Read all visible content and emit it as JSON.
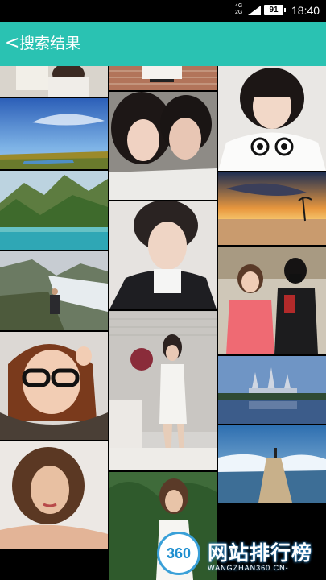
{
  "status_bar": {
    "network_top": "4G",
    "network_bottom": "2G",
    "battery": "91",
    "time": "18:40"
  },
  "app_bar": {
    "back_icon": "<",
    "title": "搜索结果"
  },
  "results": {
    "columns": 3,
    "images": [
      {
        "id": "photo-1",
        "subject": "girl-portrait-top"
      },
      {
        "id": "photo-2",
        "subject": "blue-sky-lake"
      },
      {
        "id": "photo-3",
        "subject": "mountain-lake"
      },
      {
        "id": "photo-4",
        "subject": "glacier-hiker"
      },
      {
        "id": "photo-5",
        "subject": "girl-glasses"
      },
      {
        "id": "photo-6",
        "subject": "woman-curly-hair"
      },
      {
        "id": "photo-7",
        "subject": "girl-pose-top"
      },
      {
        "id": "photo-8",
        "subject": "couple-selfie"
      },
      {
        "id": "photo-9",
        "subject": "boy-portrait"
      },
      {
        "id": "photo-10",
        "subject": "woman-white-dress"
      },
      {
        "id": "photo-11",
        "subject": "woman-garden"
      },
      {
        "id": "photo-12",
        "subject": "girl-bob-hair"
      },
      {
        "id": "photo-13",
        "subject": "sunset-beach"
      },
      {
        "id": "photo-14",
        "subject": "couple-mall"
      },
      {
        "id": "photo-15",
        "subject": "castle-lake"
      },
      {
        "id": "photo-16",
        "subject": "pier-waves"
      }
    ]
  },
  "watermark": {
    "logo_text": "360",
    "name": "网站排行榜",
    "url": "WANGZHAN360.CN-"
  }
}
